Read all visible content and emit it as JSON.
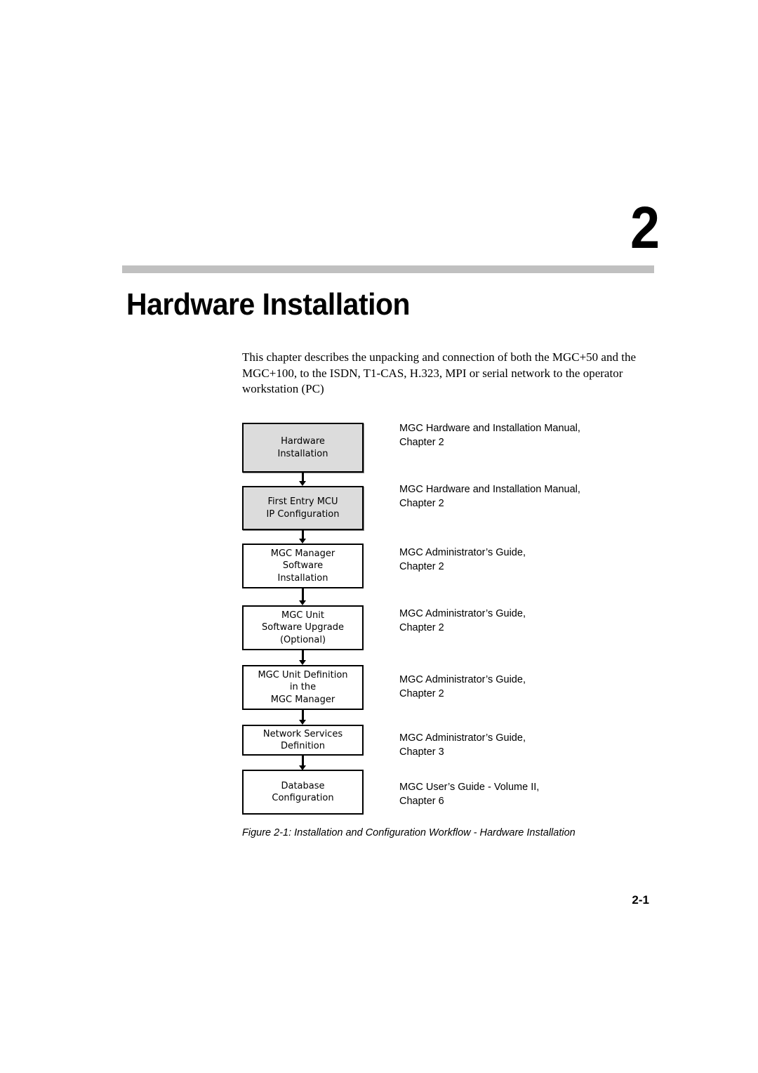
{
  "chapter": {
    "number": "2",
    "title": "Hardware Installation",
    "intro": "This chapter describes the unpacking and connection of both the MGC+50 and the MGC+100, to the ISDN, T1-CAS, H.323, MPI or serial network to the operator workstation (PC)"
  },
  "workflow": {
    "steps": [
      {
        "label": "Hardware\nInstallation",
        "reference": "MGC Hardware and Installation Manual,\nChapter 2",
        "highlighted": true
      },
      {
        "label": "First Entry MCU\nIP Configuration",
        "reference": "MGC Hardware and Installation Manual,\nChapter 2",
        "highlighted": true
      },
      {
        "label": "MGC Manager\nSoftware\nInstallation",
        "reference": "MGC Administrator’s Guide,\nChapter 2",
        "highlighted": false
      },
      {
        "label": "MGC Unit\nSoftware Upgrade\n(Optional)",
        "reference": "MGC Administrator’s Guide,\nChapter 2",
        "highlighted": false
      },
      {
        "label": "MGC Unit Definition\nin the\nMGC Manager",
        "reference": "MGC Administrator’s Guide,\nChapter 2",
        "highlighted": false
      },
      {
        "label": "Network Services\nDefinition",
        "reference": "MGC Administrator’s Guide,\nChapter 3",
        "highlighted": false
      },
      {
        "label": "Database\nConfiguration",
        "reference": "MGC User’s Guide - Volume II,\nChapter 6",
        "highlighted": false
      }
    ],
    "caption": "Figure 2-1: Installation and Configuration Workflow - Hardware Installation"
  },
  "footer": {
    "page_number": "2-1"
  }
}
